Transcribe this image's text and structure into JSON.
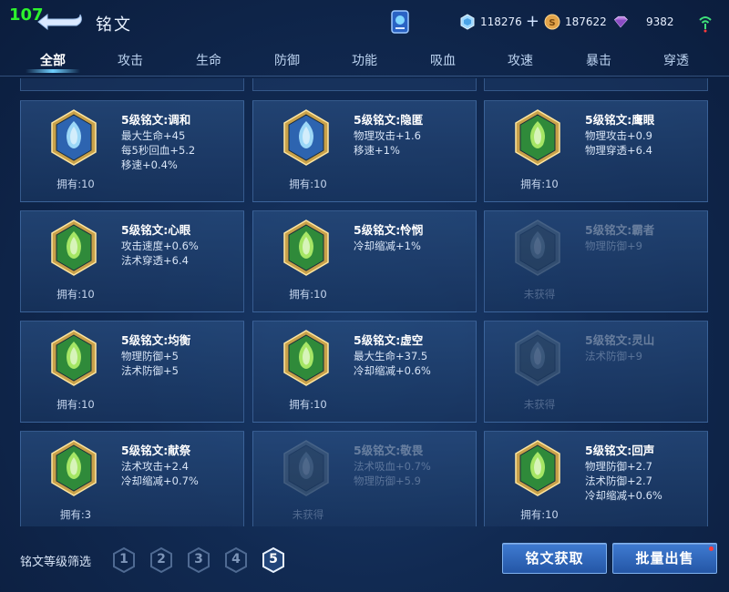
{
  "header": {
    "fps": "107",
    "title": "铭文",
    "resources": [
      {
        "icon": "diamond-icon",
        "value": "118276",
        "plus": "+"
      },
      {
        "icon": "gold-coin-icon",
        "value": "187622"
      },
      {
        "icon": "gem-icon",
        "value": "9382"
      }
    ]
  },
  "tabs": [
    "全部",
    "攻击",
    "生命",
    "防御",
    "功能",
    "吸血",
    "攻速",
    "暴击",
    "穿透"
  ],
  "active_tab": "全部",
  "cards": [
    {
      "name": "5级铭文:调和",
      "stats": [
        "最大生命+45",
        "每5秒回血+5.2",
        "移速+0.4%"
      ],
      "owned": "拥有:10",
      "color": "blue",
      "locked": false
    },
    {
      "name": "5级铭文:隐匿",
      "stats": [
        "物理攻击+1.6",
        "移速+1%"
      ],
      "owned": "拥有:10",
      "color": "blue",
      "locked": false
    },
    {
      "name": "5级铭文:鹰眼",
      "stats": [
        "物理攻击+0.9",
        "物理穿透+6.4"
      ],
      "owned": "拥有:10",
      "color": "green",
      "locked": false
    },
    {
      "name": "5级铭文:心眼",
      "stats": [
        "攻击速度+0.6%",
        "法术穿透+6.4"
      ],
      "owned": "拥有:10",
      "color": "green",
      "locked": false
    },
    {
      "name": "5级铭文:怜悯",
      "stats": [
        "冷却缩减+1%"
      ],
      "owned": "拥有:10",
      "color": "green",
      "locked": false
    },
    {
      "name": "5级铭文:霸者",
      "stats": [
        "物理防御+9"
      ],
      "owned": "未获得",
      "color": "gray",
      "locked": true
    },
    {
      "name": "5级铭文:均衡",
      "stats": [
        "物理防御+5",
        "法术防御+5"
      ],
      "owned": "拥有:10",
      "color": "green",
      "locked": false
    },
    {
      "name": "5级铭文:虚空",
      "stats": [
        "最大生命+37.5",
        "冷却缩减+0.6%"
      ],
      "owned": "拥有:10",
      "color": "green",
      "locked": false
    },
    {
      "name": "5级铭文:灵山",
      "stats": [
        "法术防御+9"
      ],
      "owned": "未获得",
      "color": "gray",
      "locked": true
    },
    {
      "name": "5级铭文:献祭",
      "stats": [
        "法术攻击+2.4",
        "冷却缩减+0.7%"
      ],
      "owned": "拥有:3",
      "color": "green",
      "locked": false
    },
    {
      "name": "5级铭文:敬畏",
      "stats": [
        "法术吸血+0.7%",
        "物理防御+5.9"
      ],
      "owned": "未获得",
      "color": "gray",
      "locked": true
    },
    {
      "name": "5级铭文:回声",
      "stats": [
        "物理防御+2.7",
        "法术防御+2.7",
        "冷却缩减+0.6%"
      ],
      "owned": "拥有:10",
      "color": "green",
      "locked": false
    }
  ],
  "footer": {
    "filter_label": "铭文等级筛选",
    "levels": [
      "1",
      "2",
      "3",
      "4",
      "5"
    ],
    "active_level": "5",
    "get_button": "铭文获取",
    "sell_button": "批量出售"
  },
  "colors": {
    "accent": "#3f7bd1",
    "fps": "#2df22d",
    "alert": "#ff3b3b"
  }
}
